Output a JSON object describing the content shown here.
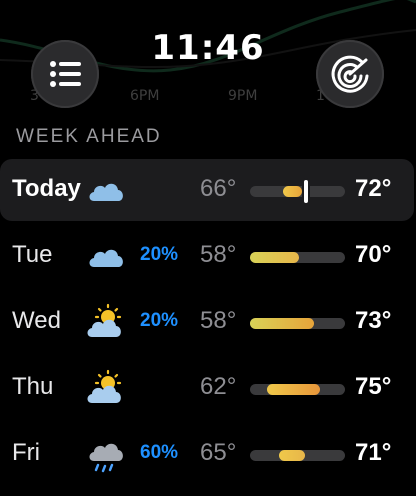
{
  "header": {
    "time": "11:46",
    "background_hours": [
      "3",
      "6PM",
      "9PM",
      "1"
    ]
  },
  "section_title": "WEEK AHEAD",
  "forecast": [
    {
      "day": "Today",
      "icon": "cloud-icon",
      "precip": "",
      "low": "66°",
      "high": "72°",
      "range_start": 0.35,
      "range_end": 0.55,
      "current_marker": 0.59,
      "colors": [
        "#f0c94a",
        "#e7a43a"
      ]
    },
    {
      "day": "Tue",
      "icon": "cloud-icon",
      "precip": "20%",
      "low": "58°",
      "high": "70°",
      "range_start": 0.0,
      "range_end": 0.52,
      "colors": [
        "#d8d257",
        "#e7b64a"
      ]
    },
    {
      "day": "Wed",
      "icon": "partly-sunny-icon",
      "precip": "20%",
      "low": "58°",
      "high": "73°",
      "range_start": 0.0,
      "range_end": 0.67,
      "colors": [
        "#d8d257",
        "#e7a43a"
      ]
    },
    {
      "day": "Thu",
      "icon": "partly-sunny-icon",
      "precip": "",
      "low": "62°",
      "high": "75°",
      "range_start": 0.18,
      "range_end": 0.74,
      "colors": [
        "#f0c94a",
        "#e7963a"
      ]
    },
    {
      "day": "Fri",
      "icon": "rain-cloud-icon",
      "precip": "60%",
      "low": "65°",
      "high": "71°",
      "range_start": 0.31,
      "range_end": 0.58,
      "colors": [
        "#f0c94a",
        "#e7b64a"
      ]
    }
  ],
  "colors": {
    "precip": "#1e90ff",
    "track": "#3a3a3c",
    "today_row_bg": "#1c1c1e"
  }
}
